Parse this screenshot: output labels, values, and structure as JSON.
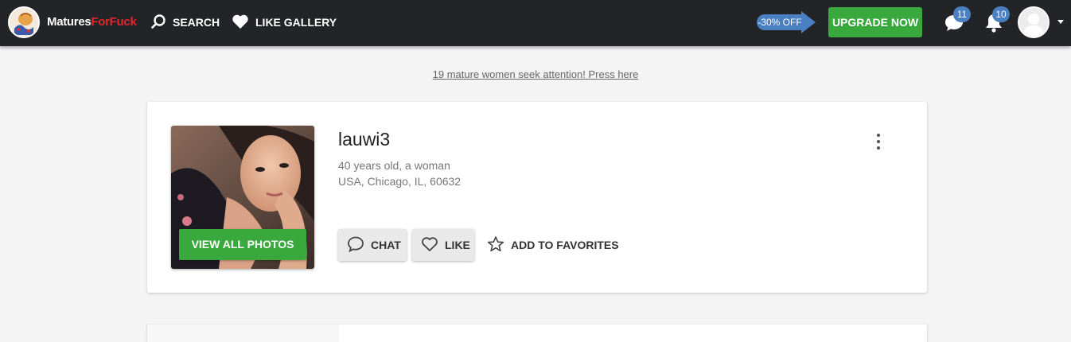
{
  "header": {
    "logo_part1": "Matures",
    "logo_part2": "ForFuck",
    "nav": {
      "search_label": "SEARCH",
      "like_gallery_label": "LIKE GALLERY"
    },
    "discount_label": "-30% OFF",
    "upgrade_label": "UPGRADE NOW",
    "messages_count": "11",
    "notifications_count": "10",
    "icons": [
      "search-icon",
      "heart-icon",
      "chat-bubble-icon",
      "bell-icon",
      "user-avatar",
      "caret-down-icon"
    ]
  },
  "promo": {
    "text": "19 mature women seek attention! Press here"
  },
  "profile": {
    "username": "lauwi3",
    "age_gender": "40 years old, a woman",
    "location": "USA, Chicago, IL, 60632",
    "view_photos_label": "VIEW ALL PHOTOS",
    "actions": {
      "chat_label": "CHAT",
      "like_label": "LIKE",
      "favorites_label": "ADD TO FAVORITES"
    }
  },
  "colors": {
    "topbar": "#232427",
    "accent_green": "#39a83d",
    "badge_blue": "#4a7fc1",
    "logo_red": "#e3262b",
    "page_bg": "#f4f4f4"
  }
}
